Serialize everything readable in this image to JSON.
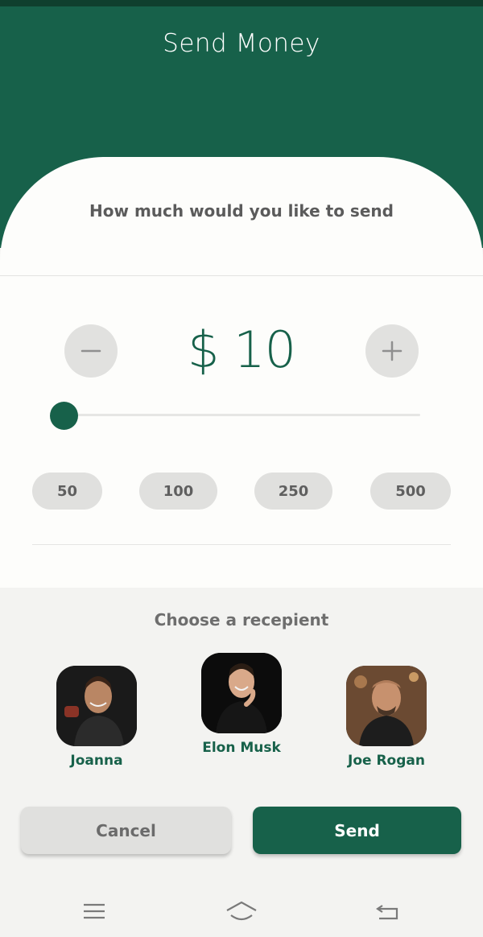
{
  "header": {
    "title": "Send Money"
  },
  "amount_section": {
    "question": "How much would you like to send",
    "amount": "$ 10",
    "minus_icon": "minus-icon",
    "plus_icon": "plus-icon",
    "slider_value": 10,
    "presets": [
      "50",
      "100",
      "250",
      "500"
    ]
  },
  "recipients_section": {
    "title": "Choose a recepient",
    "recipients": [
      {
        "name": "Joanna"
      },
      {
        "name": "Elon Musk"
      },
      {
        "name": "Joe Rogan"
      }
    ]
  },
  "actions": {
    "cancel_label": "Cancel",
    "send_label": "Send"
  },
  "nav": {
    "icons": [
      "menu-icon",
      "home-icon",
      "back-icon"
    ]
  },
  "colors": {
    "primary": "#17614a",
    "status_bar": "#0f3f2e",
    "chip": "#e0e0de",
    "background": "#f3f3f1"
  }
}
